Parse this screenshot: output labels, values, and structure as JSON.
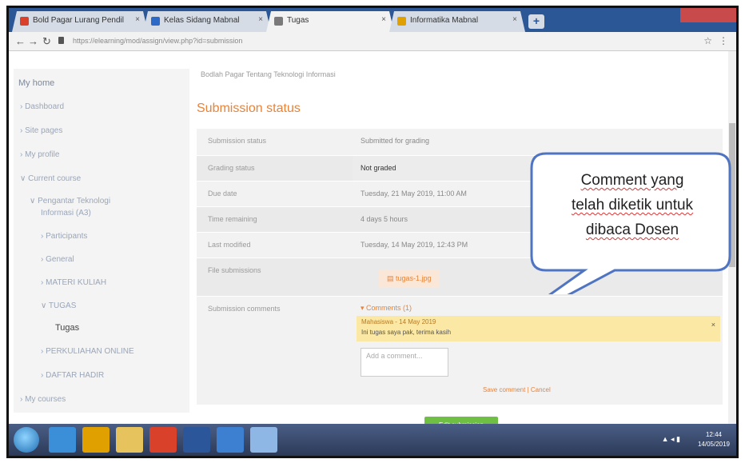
{
  "browser": {
    "tabs": [
      {
        "label": "Bold Pagar Lurang Pendil",
        "favicon_color": "#d9412a",
        "active": false
      },
      {
        "label": "Kelas Sidang Mabnal",
        "favicon_color": "#2d69c7",
        "active": false
      },
      {
        "label": "Tugas",
        "favicon_color": "#7a7a7a",
        "active": true
      },
      {
        "label": "Informatika Mabnal",
        "favicon_color": "#e0a100",
        "active": false
      }
    ],
    "new_tab": "+",
    "url": "https://elearning/mod/assign/view.php?id=submission"
  },
  "sidebar": {
    "items": [
      {
        "label": "My home",
        "kind": "head"
      },
      {
        "label": "› Dashboard",
        "kind": "link"
      },
      {
        "label": "› Site pages",
        "kind": "link"
      },
      {
        "label": "› My profile",
        "kind": "link"
      },
      {
        "label": "∨ Current course",
        "kind": "link"
      },
      {
        "label": "∨ Pengantar Teknologi",
        "kind": "link"
      },
      {
        "label": "Informasi (A3)",
        "kind": "link"
      },
      {
        "label": "› Participants",
        "kind": "link"
      },
      {
        "label": "› General",
        "kind": "link"
      },
      {
        "label": "› MATERI KULIAH",
        "kind": "link"
      },
      {
        "label": "∨ TUGAS",
        "kind": "link"
      },
      {
        "label": "Tugas",
        "kind": "current"
      },
      {
        "label": "› PERKULIAHAN ONLINE",
        "kind": "link"
      },
      {
        "label": "› DAFTAR HADIR",
        "kind": "link"
      },
      {
        "label": "› My courses",
        "kind": "link"
      }
    ]
  },
  "main": {
    "breadcrumb": "Bodlah Pagar Tentang Teknologi Informasi",
    "section_title": "Submission status",
    "status_rows": [
      {
        "label": "Submission status",
        "value": "Submitted for grading"
      },
      {
        "label": "Grading status",
        "value": "Not graded"
      },
      {
        "label": "Due date",
        "value": "Tuesday, 21 May 2019, 11:00 AM"
      },
      {
        "label": "Time remaining",
        "value": "4 days 5 hours"
      },
      {
        "label": "Last modified",
        "value": "Tuesday, 14 May 2019, 12:43 PM"
      },
      {
        "label": "File submissions",
        "value": "tugas-1.jpg"
      }
    ],
    "comments": {
      "label": "Submission comments",
      "toggle": "▾ Comments (1)",
      "author": "Mahasiswa - 14 May 2019",
      "text": "Ini tugas saya pak, terima kasih",
      "close": "×",
      "placeholder": "Add a comment...",
      "actions": "Save comment | Cancel"
    },
    "edit_button": "Edit submission"
  },
  "callout": {
    "lines": [
      "Comment yang",
      "telah diketik untuk",
      "dibaca Dosen"
    ]
  },
  "taskbar": {
    "apps": [
      {
        "name": "ie-icon",
        "color": "#3a8fd8"
      },
      {
        "name": "media-icon",
        "color": "#e0a100"
      },
      {
        "name": "explorer-icon",
        "color": "#e6c35c"
      },
      {
        "name": "chrome-icon",
        "color": "#d9412a"
      },
      {
        "name": "word-icon",
        "color": "#2b579a"
      },
      {
        "name": "paint-icon",
        "color": "#3d7fd0"
      },
      {
        "name": "app-icon",
        "color": "#8fb7e6"
      }
    ],
    "tray": "▲ ◂ ▮",
    "time": "12:44",
    "date": "14/05/2019"
  }
}
